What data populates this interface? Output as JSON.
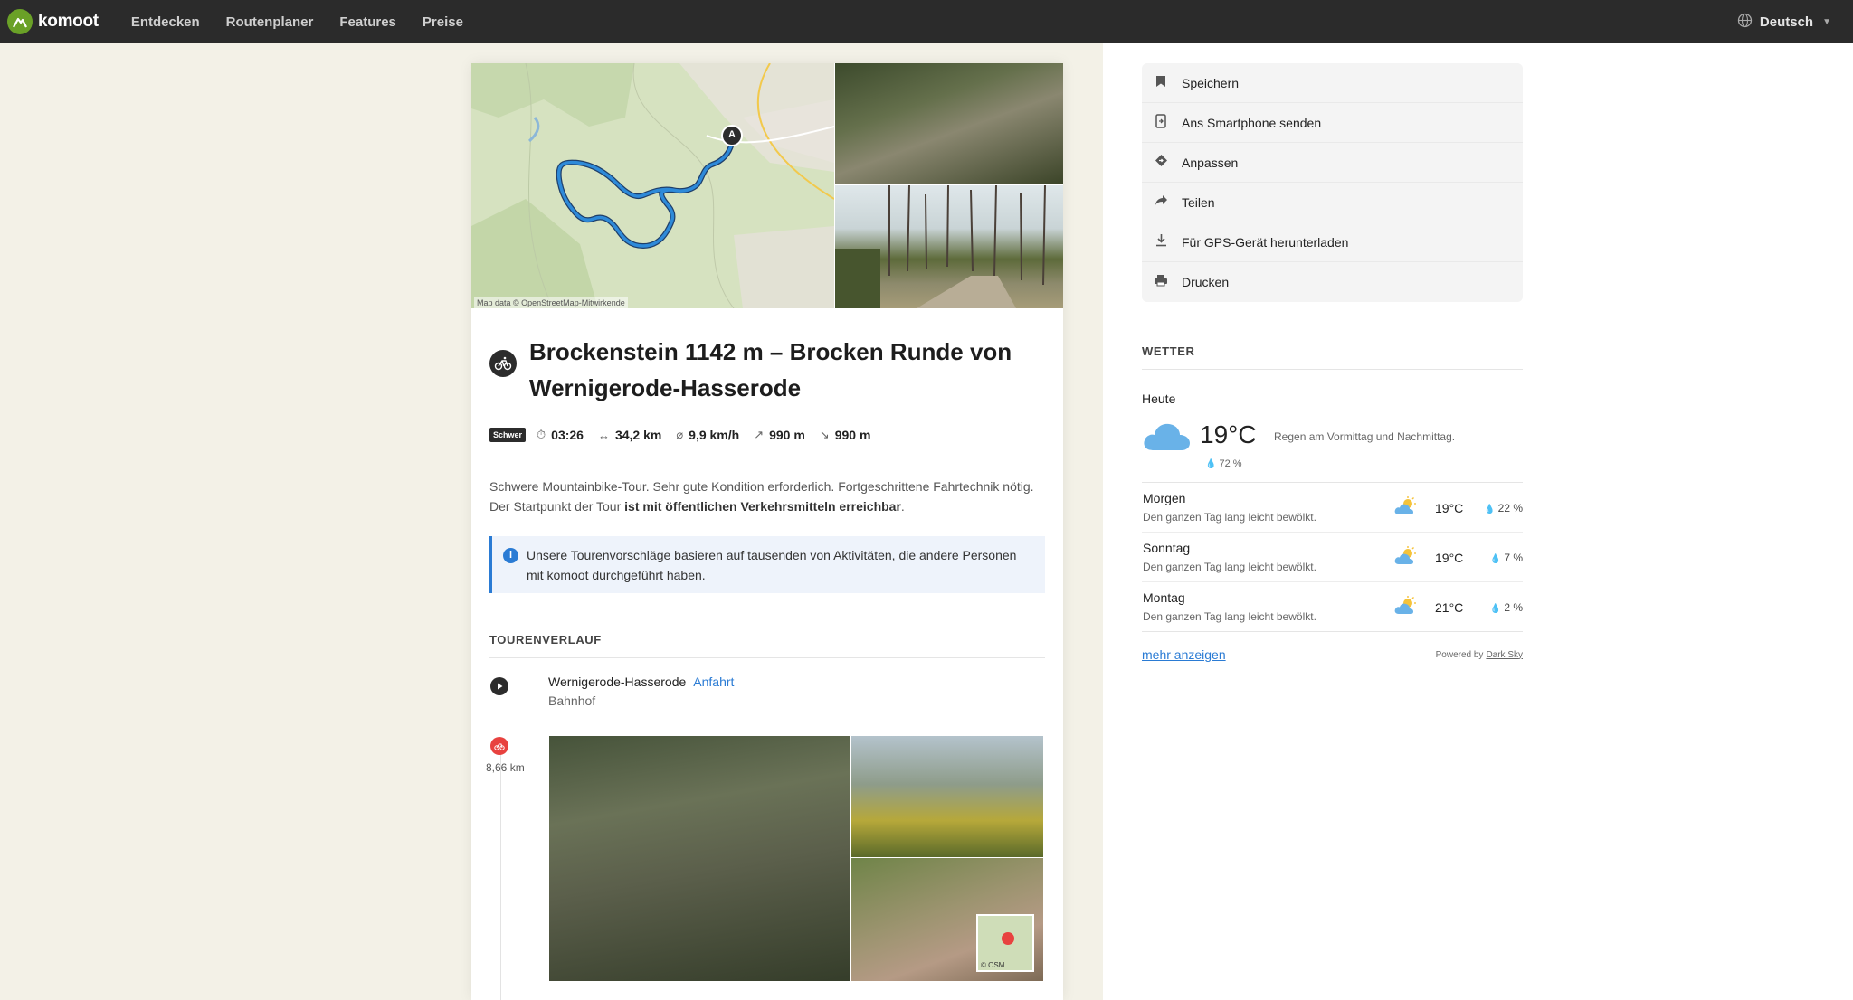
{
  "nav": {
    "brand": "komoot",
    "links": [
      "Entdecken",
      "Routenplaner",
      "Features",
      "Preise"
    ],
    "language": "Deutsch"
  },
  "map": {
    "start_marker": "A",
    "attribution": "Map data © OpenStreetMap-Mitwirkende"
  },
  "tour": {
    "title": "Brockenstein 1142 m – Brocken Runde von Wernigerode-Hasserode",
    "difficulty": "Schwer",
    "duration": "03:26",
    "distance": "34,2 km",
    "speed": "9,9 km/h",
    "ascent": "990 m",
    "descent": "990 m",
    "description_plain": "Schwere Mountainbike-Tour. Sehr gute Kondition erforderlich. Fortgeschrittene Fahrtechnik nötig. Der Startpunkt der Tour ",
    "description_bold": "ist mit öffentlichen Verkehrsmitteln erreichbar",
    "description_end": ".",
    "notice": "Unsere Tourenvorschläge basieren auf tausenden von Aktivitäten, die andere Personen mit komoot durchgeführt haben."
  },
  "itinerary": {
    "heading": "TOURENVERLAUF",
    "start_name": "Wernigerode-Hasserode",
    "start_link": "Anfahrt",
    "start_sub": "Bahnhof",
    "highlight_km": "8,66 km",
    "mini_map_label": "© OSM"
  },
  "actions": [
    {
      "label": "Speichern",
      "icon": "bookmark-icon"
    },
    {
      "label": "Ans Smartphone senden",
      "icon": "smartphone-send-icon"
    },
    {
      "label": "Anpassen",
      "icon": "diamond-edit-icon"
    },
    {
      "label": "Teilen",
      "icon": "share-arrow-icon"
    },
    {
      "label": "Für GPS-Gerät herunterladen",
      "icon": "download-icon"
    },
    {
      "label": "Drucken",
      "icon": "printer-icon"
    }
  ],
  "weather": {
    "heading": "WETTER",
    "today_label": "Heute",
    "today_temp": "19°C",
    "today_desc": "Regen am Vormittag und Nachmittag.",
    "today_rain": "72 %",
    "days": [
      {
        "name": "Morgen",
        "desc": "Den ganzen Tag lang leicht bewölkt.",
        "temp": "19°C",
        "rain": "22 %"
      },
      {
        "name": "Sonntag",
        "desc": "Den ganzen Tag lang leicht bewölkt.",
        "temp": "19°C",
        "rain": "7 %"
      },
      {
        "name": "Montag",
        "desc": "Den ganzen Tag lang leicht bewölkt.",
        "temp": "21°C",
        "rain": "2 %"
      }
    ],
    "more_label": "mehr anzeigen",
    "powered_by": "Powered by",
    "powered_link": "Dark Sky"
  },
  "colors": {
    "brand_green": "#6aa127",
    "route_blue": "#1f78c8",
    "link_blue": "#2a7bd4",
    "highlight_red": "#e8423f",
    "nav_bg": "#2b2b2b"
  }
}
